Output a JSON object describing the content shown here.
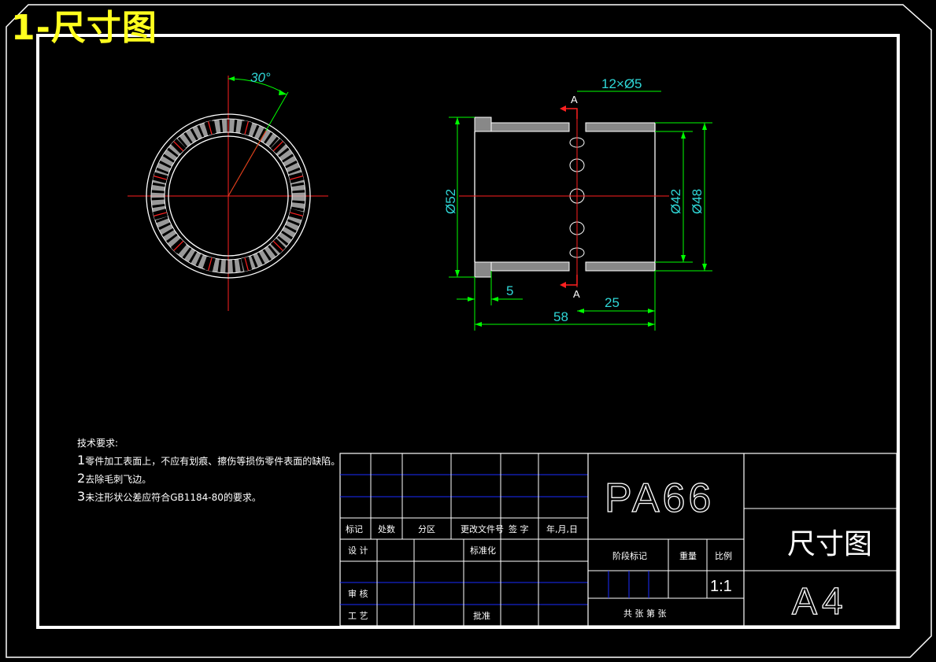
{
  "heading": "1-尺寸图",
  "dimensions": {
    "angle": "30°",
    "holes": "12×Ø5",
    "dia_outer": "Ø52",
    "dia_inner": "Ø42",
    "dia_flange": "Ø48",
    "flange_width": "5",
    "hole_offset": "25",
    "length": "58",
    "section_mark": "A"
  },
  "notes": {
    "title": "技术要求:",
    "items": [
      {
        "num": "1",
        "text": "零件加工表面上，不应有划痕、擦伤等损伤零件表面的缺陷。"
      },
      {
        "num": "2",
        "text": "去除毛刺飞边。"
      },
      {
        "num": "3",
        "text": "未注形状公差应符合GB1184-80的要求。"
      }
    ]
  },
  "title_block": {
    "material": "PA66",
    "drawing_name": "尺寸图",
    "sheet_size": "A4",
    "scale": "1:1",
    "header_labels": [
      "标记",
      "处数",
      "分区",
      "更改文件号",
      "签 字",
      "年,月,日"
    ],
    "design": "设 计",
    "standardize": "标准化",
    "review": "审 核",
    "process": "工 艺",
    "approve": "批准",
    "stage_mark": "阶段标记",
    "weight": "重量",
    "ratio": "比例",
    "sheets": "共  张  第  张"
  },
  "colors": {
    "background": "#000000",
    "frame": "#ffffff",
    "heading": "#ffff1e",
    "centerline": "#ff2020",
    "dimension": "#00ff00",
    "dimension_text": "#2fd6d6",
    "grid_line": "#1a2cff"
  }
}
